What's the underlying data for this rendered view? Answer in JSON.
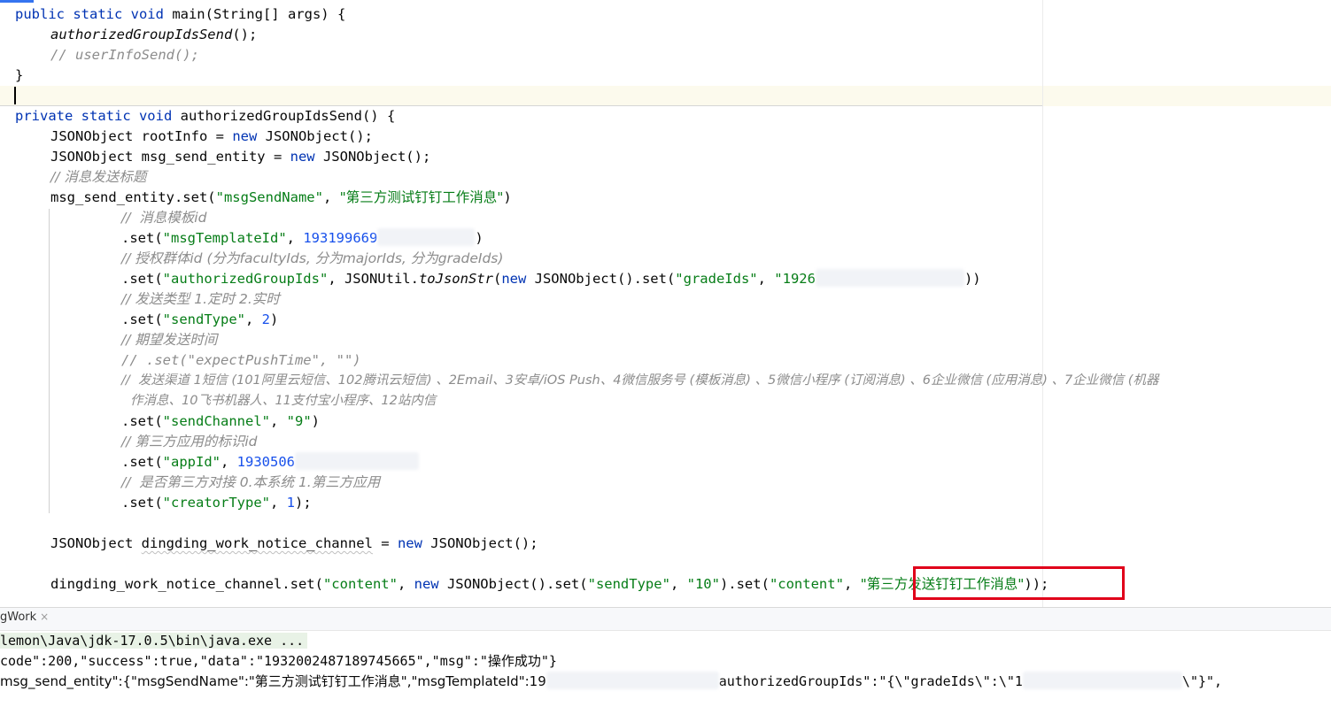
{
  "editor": {
    "main_sig": {
      "kw": "public static void",
      "rest": " main(String[] args) {"
    },
    "call_auth": "authorizedGroupIdsSend",
    "call_auth_tail": "();",
    "comment_user": "// userInfoSend();",
    "close_brace": "}",
    "method_sig": {
      "kw": "private static void",
      "rest": " authorizedGroupIdsSend() {"
    },
    "root_info": {
      "a": "JSONObject rootInfo = ",
      "kw": "new",
      "b": " JSONObject();"
    },
    "msg_send_entity": {
      "a": "JSONObject msg_send_entity = ",
      "kw": "new",
      "b": " JSONObject();"
    },
    "comment_title": "// 消息发送标题",
    "set_name": {
      "a": "msg_send_entity.set(",
      "key": "\"msgSendName\"",
      "sep": ", ",
      "val": "\"第三方测试钉钉工作消息\"",
      "end": ")"
    },
    "comment_template": "//  消息模板id",
    "set_template": {
      "a": ".set(",
      "key": "\"msgTemplateId\"",
      "sep": ", ",
      "num": "193199669",
      "end": ")"
    },
    "comment_group": "// 授权群体id (分为facultyIds, 分为majorIds, 分为gradeIds)",
    "set_group": {
      "a": ".set(",
      "key": "\"authorizedGroupIds\"",
      "b": ", JSONUtil.",
      "fn": "toJsonStr",
      "c": "(",
      "kw": "new",
      "d": " JSONObject().set(",
      "key2": "\"gradeIds\"",
      "sep": ", ",
      "val": "\"1926",
      "end": "))"
    },
    "comment_send_type": "// 发送类型 1.定时 2.实时",
    "set_send_type": {
      "a": ".set(",
      "key": "\"sendType\"",
      "sep": ", ",
      "num": "2",
      "end": ")"
    },
    "comment_expect": "// 期望发送时间",
    "comment_expect_set": "// .set(\"expectPushTime\", \"\")",
    "comment_channel_1": "//  发送渠道 1短信 (101阿里云短信、102腾讯云短信) 、2Email、3安卓/iOS Push、4微信服务号 (模板消息) 、5微信小程序 (订阅消息) 、6企业微信 (应用消息) 、7企业微信 (机器",
    "comment_channel_2": "作消息、10飞书机器人、11支付宝小程序、12站内信",
    "set_channel": {
      "a": ".set(",
      "key": "\"sendChannel\"",
      "sep": ", ",
      "val": "\"9\"",
      "end": ")"
    },
    "comment_app": "// 第三方应用的标识id",
    "set_app": {
      "a": ".set(",
      "key": "\"appId\"",
      "sep": ", ",
      "num": "1930506"
    },
    "comment_creator": "//  是否第三方对接 0.本系统 1.第三方应用",
    "set_creator": {
      "a": ".set(",
      "key": "\"creatorType\"",
      "sep": ", ",
      "num": "1",
      "end": ");"
    },
    "dd_decl": {
      "a": "JSONObject ",
      "var": "dingding_work_notice_channel",
      "b": " = ",
      "kw": "new",
      "c": " JSONObject();"
    },
    "dd_set": {
      "a": "dingding_work_notice_channel.set(",
      "key": "\"content\"",
      "sep": ", ",
      "kw": "new",
      "b": " JSONObject().set(",
      "key2": "\"sendType\"",
      "sep2": ", ",
      "val2": "\"10\"",
      "c": ").set(",
      "key3": "\"content\"",
      "sep3": ", ",
      "val3": "\"第三方发送钉钉工作消息\"",
      "end": "));"
    }
  },
  "run_panel": {
    "tab_label": "gWork",
    "close_glyph": "×",
    "line_cmd": "lemon\\Java\\jdk-17.0.5\\bin\\java.exe ...",
    "line_response": "code\":200,\"success\":true,\"data\":\"1932002487189745665\",\"msg\":\"操作成功\"}",
    "line_entity_a": "msg_send_entity\":{\"msgSendName\":\"第三方测试钉钉工作消息\",\"msgTemplateId\":19",
    "line_entity_b": "authorizedGroupIds\":\"{\\\"gradeIds\\\":\\\"1",
    "line_entity_c": "\\\"}\","
  },
  "colors": {
    "keyword": "#0033b3",
    "string": "#067d17",
    "number": "#1750eb",
    "comment": "#8c8c8c",
    "highlight_box": "#e0001a"
  }
}
